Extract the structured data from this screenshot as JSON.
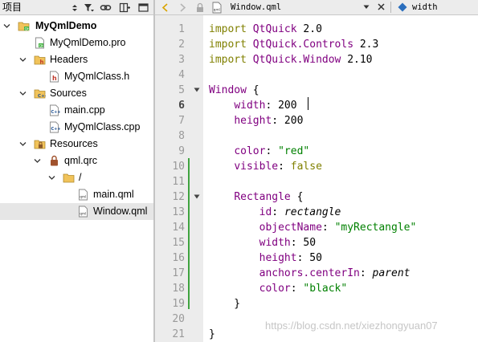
{
  "left_panel": {
    "title": "项目",
    "tree": [
      {
        "label": "MyQmlDemo",
        "bold": true
      },
      {
        "label": "MyQmlDemo.pro"
      },
      {
        "label": "Headers"
      },
      {
        "label": "MyQmlClass.h"
      },
      {
        "label": "Sources"
      },
      {
        "label": "main.cpp"
      },
      {
        "label": "MyQmlClass.cpp"
      },
      {
        "label": "Resources"
      },
      {
        "label": "qml.qrc"
      },
      {
        "label": "/"
      },
      {
        "label": "main.qml"
      },
      {
        "label": "Window.qml",
        "selected": true
      }
    ]
  },
  "editor_toolbar": {
    "file_name": "Window.qml",
    "symbol": "width"
  },
  "editor": {
    "current_line": 6,
    "lines": [
      {
        "n": "1",
        "t": "import QtQuick 2.0"
      },
      {
        "n": "2",
        "t": "import QtQuick.Controls 2.3"
      },
      {
        "n": "3",
        "t": "import QtQuick.Window 2.10"
      },
      {
        "n": "4",
        "t": ""
      },
      {
        "n": "5",
        "t": "Window {"
      },
      {
        "n": "6",
        "t": "    width: 200"
      },
      {
        "n": "7",
        "t": "    height: 200"
      },
      {
        "n": "8",
        "t": ""
      },
      {
        "n": "9",
        "t": "    color: \"red\""
      },
      {
        "n": "10",
        "t": "    visible: false"
      },
      {
        "n": "11",
        "t": ""
      },
      {
        "n": "12",
        "t": "    Rectangle {"
      },
      {
        "n": "13",
        "t": "        id: rectangle"
      },
      {
        "n": "14",
        "t": "        objectName: \"myRectangle\""
      },
      {
        "n": "15",
        "t": "        width: 50"
      },
      {
        "n": "16",
        "t": "        height: 50"
      },
      {
        "n": "17",
        "t": "        anchors.centerIn: parent"
      },
      {
        "n": "18",
        "t": "        color: \"black\""
      },
      {
        "n": "19",
        "t": "    }"
      },
      {
        "n": "20",
        "t": ""
      },
      {
        "n": "21",
        "t": "}"
      }
    ]
  },
  "watermark": "https://blog.csdn.net/xiezhongyuan07",
  "colors": {
    "keyword": "#808000",
    "object_type": "#800080",
    "string": "#008000",
    "change_marker": "#3fa33f"
  }
}
